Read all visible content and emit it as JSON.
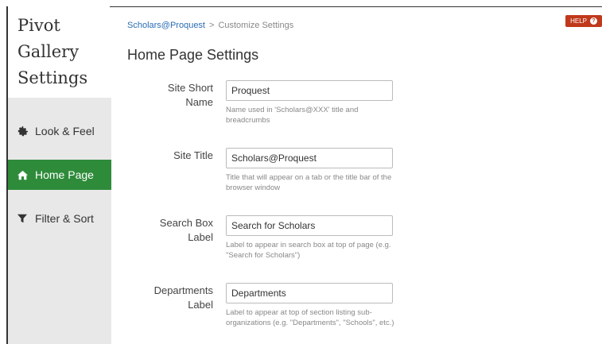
{
  "sidebar": {
    "title": "Pivot Gallery Settings",
    "items": [
      {
        "label": "Look & Feel",
        "icon": "gear-icon"
      },
      {
        "label": "Home Page",
        "icon": "home-icon"
      },
      {
        "label": "Filter & Sort",
        "icon": "filter-icon"
      }
    ],
    "active": "Home Page"
  },
  "breadcrumb": {
    "root": "Scholars@Proquest",
    "separator": ">",
    "current": "Customize Settings"
  },
  "help": {
    "label": "HELP"
  },
  "page": {
    "title": "Home Page Settings"
  },
  "fields": [
    {
      "label": "Site Short Name",
      "value": "Proquest",
      "help": "Name used in 'Scholars@XXX' title and breadcrumbs"
    },
    {
      "label": "Site Title",
      "value": "Scholars@Proquest",
      "help": "Title that will appear on a tab or the title bar of the browser window"
    },
    {
      "label": "Search Box Label",
      "value": "Search for Scholars",
      "help": "Label to appear in search box at top of page (e.g. \"Search for Scholars\")"
    },
    {
      "label": "Departments Label",
      "value": "Departments",
      "help": "Label to appear at top of section listing sub-organizations (e.g. \"Departments\", \"Schools\", etc.)"
    }
  ],
  "colors": {
    "active_nav": "#2e8b3a",
    "help_button": "#c0391b",
    "link": "#2a6db5"
  }
}
